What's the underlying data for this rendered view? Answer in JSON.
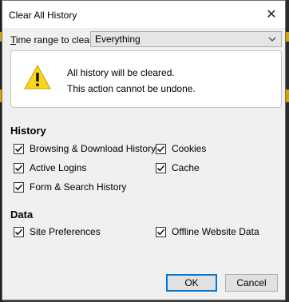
{
  "dialog": {
    "title": "Clear All History",
    "close_symbol": "✕"
  },
  "time_range": {
    "label_prefix": "T",
    "label_rest": "ime range to clear:",
    "selected": "Everything"
  },
  "warning": {
    "icon": "warning-triangle-icon",
    "line1": "All history will be cleared.",
    "line2": "This action cannot be undone."
  },
  "history": {
    "heading": "History",
    "items": [
      {
        "label": "Browsing & Download History",
        "checked": true
      },
      {
        "label": "Cookies",
        "checked": true
      },
      {
        "label": "Active Logins",
        "checked": true
      },
      {
        "label": "Cache",
        "checked": true
      },
      {
        "label": "Form & Search History",
        "checked": true
      }
    ]
  },
  "data_section": {
    "heading": "Data",
    "items": [
      {
        "label": "Site Preferences",
        "checked": true
      },
      {
        "label": "Offline Website Data",
        "checked": true
      }
    ]
  },
  "buttons": {
    "ok": "OK",
    "cancel": "Cancel"
  },
  "colors": {
    "accent": "#0078d7",
    "warning_fill": "#f8d41a"
  }
}
